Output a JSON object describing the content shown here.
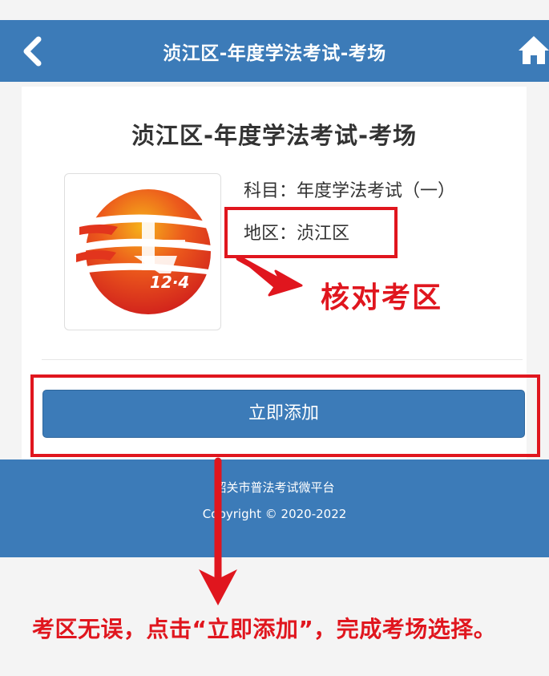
{
  "header": {
    "title": "浈江区-年度学法考试-考场",
    "back_icon": "chevron-left-icon",
    "home_icon": "home-icon"
  },
  "exam": {
    "title": "浈江区-年度学法考试-考场",
    "logo_text": "12·4",
    "logo_icon": "fa-law-logo",
    "subject": "科目：年度学法考试（一）",
    "region": "地区：浈江区"
  },
  "actions": {
    "add_label": "立即添加"
  },
  "footer": {
    "org": "韶关市普法考试微平台",
    "copyright": "Copyright © 2020-2022"
  },
  "annotations": {
    "check_region": "核对考区",
    "instruction": "考区无误，点击“立即添加”，完成考场选择。"
  },
  "colors": {
    "primary": "#3c7bb8",
    "annotation": "#e0161e",
    "page_bg": "#f4f4f4"
  }
}
